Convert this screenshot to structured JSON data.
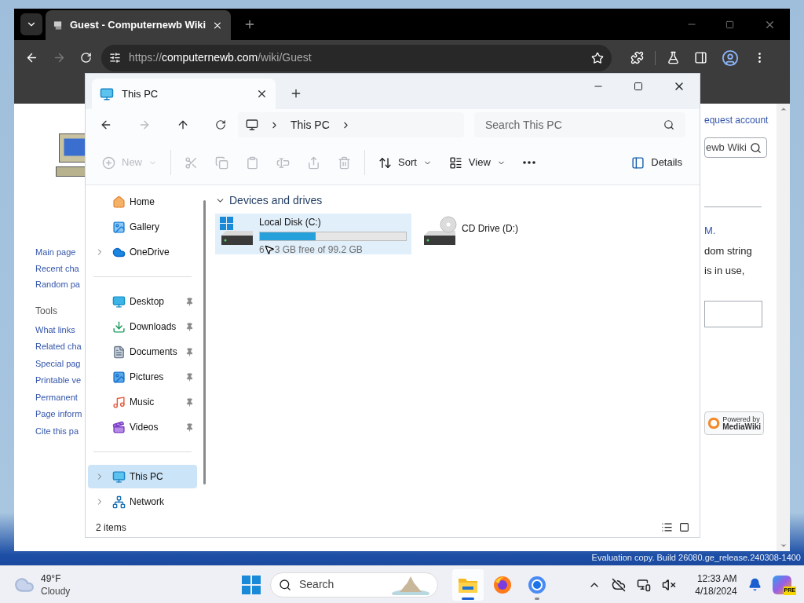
{
  "desktop": {
    "build_note": "Evaluation copy. Build 26080.ge_release.240308-1400"
  },
  "browser": {
    "tabs": [
      {
        "title": "Guest - Computernewb Wiki",
        "selected": true
      }
    ],
    "address": {
      "scheme": "https://",
      "host": "computernewb.com",
      "path": "/wiki/Guest"
    },
    "forward_disabled": true
  },
  "wiki": {
    "account_link": "equest account",
    "search_value": "ewb Wiki",
    "nav_links": [
      "Main page",
      "Recent cha",
      "Random pa"
    ],
    "tools_heading": "Tools",
    "tools_links": [
      "What links",
      "Related cha",
      "Special pag",
      "Printable ve",
      "Permanent",
      "Page inform",
      "Cite this pa"
    ],
    "body_fragments": [
      "M.",
      "dom string",
      "is in use,"
    ],
    "badge": {
      "line_1": "Powered by",
      "line_2": "MediaWiki"
    }
  },
  "explorer": {
    "tabs": [
      {
        "title": "This PC",
        "selected": true
      }
    ],
    "forward_disabled": true,
    "breadcrumb": [
      "This PC"
    ],
    "search": {
      "placeholder": "Search This PC"
    },
    "command_groups": [
      [
        {
          "kind": "new",
          "label": "New",
          "disabled": true
        }
      ],
      [
        {
          "kind": "cut",
          "disabled": true
        },
        {
          "kind": "copy",
          "disabled": true
        },
        {
          "kind": "paste",
          "disabled": true
        },
        {
          "kind": "rename",
          "disabled": true
        },
        {
          "kind": "share",
          "disabled": true
        },
        {
          "kind": "delete",
          "disabled": true
        }
      ],
      [
        {
          "kind": "sort",
          "label": "Sort",
          "disabled": false
        },
        {
          "kind": "view",
          "label": "View",
          "disabled": false
        },
        {
          "kind": "more",
          "disabled": false
        }
      ]
    ],
    "details_button": {
      "label": "Details"
    },
    "nav_groups": [
      [
        {
          "label": "Home",
          "kind": "home",
          "expandable": false,
          "pinned": false,
          "selected": false
        },
        {
          "label": "Gallery",
          "kind": "gallery",
          "expandable": false,
          "pinned": false,
          "selected": false
        },
        {
          "label": "OneDrive",
          "kind": "cloud",
          "expandable": true,
          "pinned": false,
          "selected": false
        }
      ],
      [
        {
          "label": "Desktop",
          "kind": "desktop",
          "expandable": false,
          "pinned": true,
          "selected": false
        },
        {
          "label": "Downloads",
          "kind": "downloads",
          "expandable": false,
          "pinned": true,
          "selected": false
        },
        {
          "label": "Documents",
          "kind": "documents",
          "expandable": false,
          "pinned": true,
          "selected": false
        },
        {
          "label": "Pictures",
          "kind": "pictures",
          "expandable": false,
          "pinned": true,
          "selected": false
        },
        {
          "label": "Music",
          "kind": "music",
          "expandable": false,
          "pinned": true,
          "selected": false
        },
        {
          "label": "Videos",
          "kind": "videos",
          "expandable": false,
          "pinned": true,
          "selected": false
        }
      ],
      [
        {
          "label": "This PC",
          "kind": "pc",
          "expandable": true,
          "pinned": false,
          "selected": true
        },
        {
          "label": "Network",
          "kind": "network",
          "expandable": true,
          "pinned": false,
          "selected": false
        }
      ]
    ],
    "section": {
      "title": "Devices and drives",
      "expanded": true
    },
    "drives": [
      {
        "name": "Local Disk (C:)",
        "kind": "system",
        "selected": true,
        "level": 0.38,
        "free_text_before_cursor": "6",
        "free_text_after_cursor": "3 GB free of 99.2 GB"
      },
      {
        "name": "CD Drive (D:)",
        "kind": "optical",
        "selected": false
      }
    ],
    "status": {
      "item_count": "2 items"
    }
  },
  "taskbar": {
    "weather": {
      "temperature": "49°F",
      "condition": "Cloudy"
    },
    "search": {
      "placeholder": "Search"
    },
    "apps": [
      {
        "kind": "explorer",
        "running": true,
        "active": true
      },
      {
        "kind": "firefox",
        "running": false,
        "active": false
      },
      {
        "kind": "chrome",
        "running": true,
        "active": false
      }
    ],
    "clock": {
      "time": "12:33 AM",
      "date": "4/18/2024"
    },
    "copilot_badge": "PRE"
  }
}
